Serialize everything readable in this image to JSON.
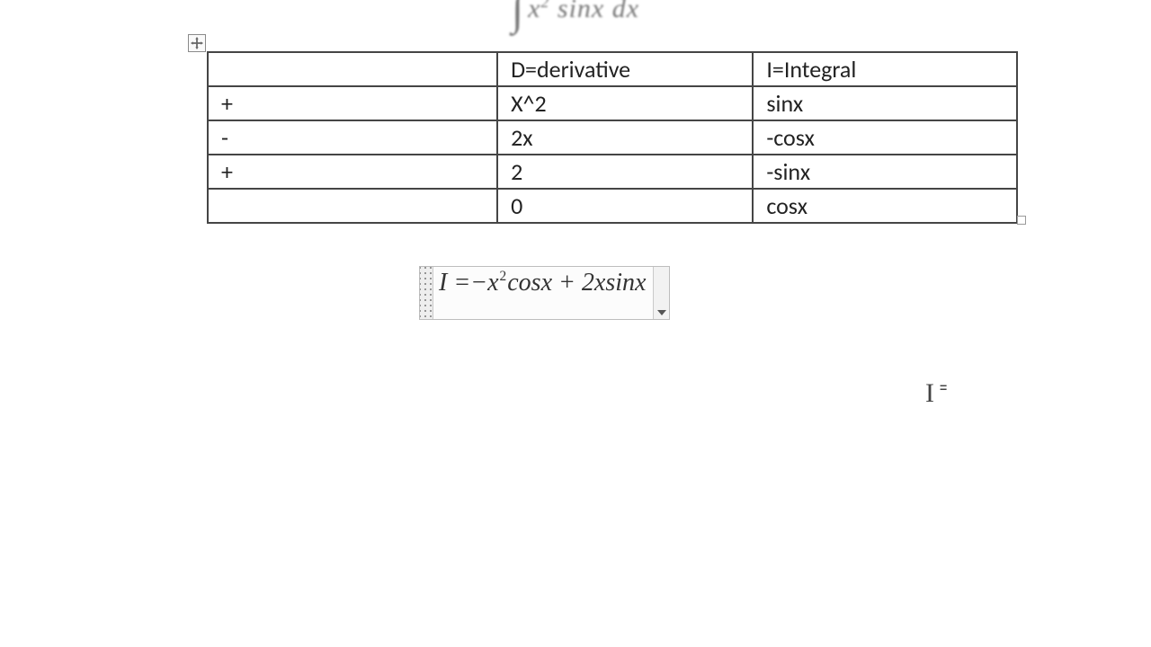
{
  "top_integral": {
    "integrand_pre": "x",
    "exponent": "2",
    "integrand_post": " sinx dx"
  },
  "table": {
    "header": {
      "sign": "",
      "d": "D=derivative",
      "i": "I=Integral"
    },
    "rows": [
      {
        "sign": "+",
        "d": "X^2",
        "i": "sinx"
      },
      {
        "sign": "-",
        "d": "2x",
        "i": "-cosx"
      },
      {
        "sign": "+",
        "d": "2",
        "i": "-sinx"
      },
      {
        "sign": "",
        "d": "0",
        "i": "cosx"
      }
    ]
  },
  "equation": {
    "lhs": "I = ",
    "term1_pre": "−x",
    "term1_exp": "2",
    "term1_post": "cosx + 2xsinx"
  },
  "cursor_glyph": "I",
  "cursor_small": "="
}
